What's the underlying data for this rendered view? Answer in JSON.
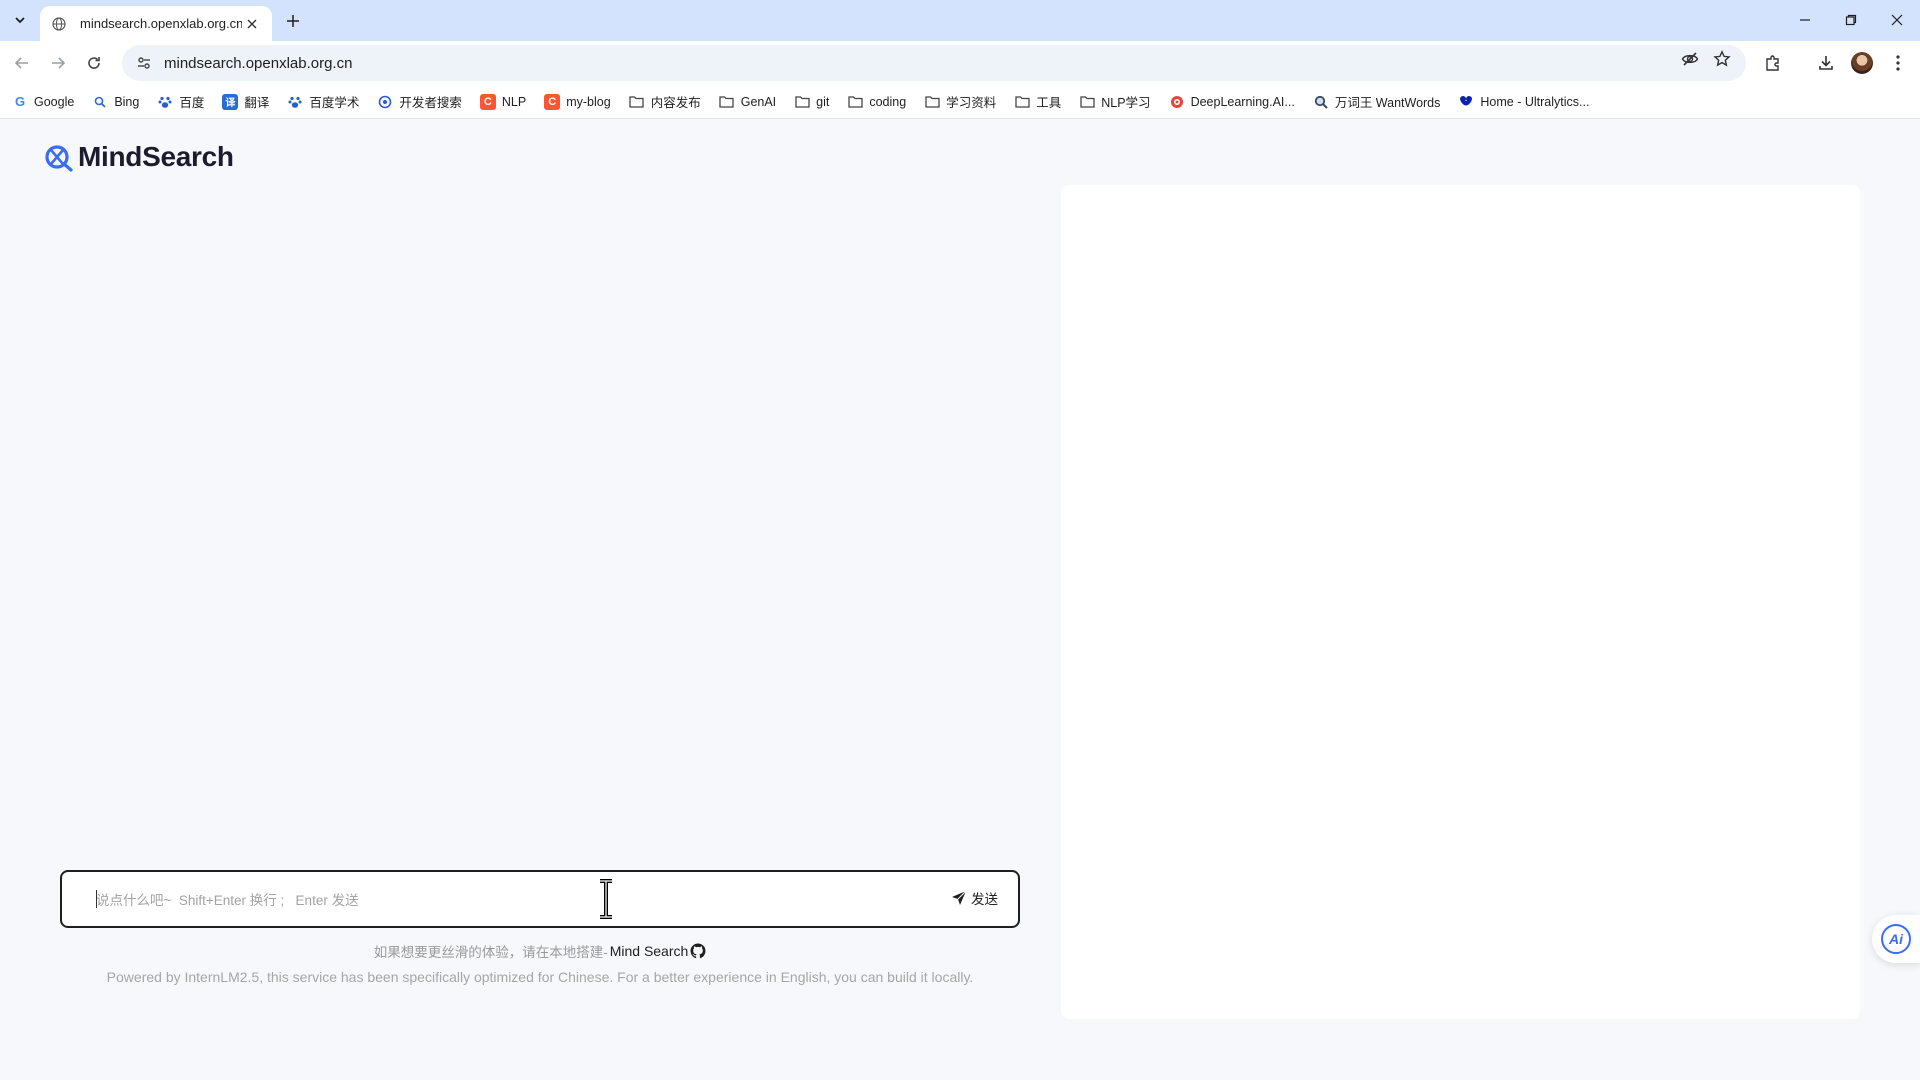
{
  "browser": {
    "tab": {
      "title": "mindsearch.openxlab.org.cn"
    },
    "address": {
      "url": "mindsearch.openxlab.org.cn"
    },
    "bookmarks": [
      {
        "label": "Google",
        "icon": "google-icon"
      },
      {
        "label": "Bing",
        "icon": "bing-search-icon"
      },
      {
        "label": "百度",
        "icon": "baidu-paw-icon"
      },
      {
        "label": "翻译",
        "icon": "translate-icon"
      },
      {
        "label": "百度学术",
        "icon": "baidu-paw-icon"
      },
      {
        "label": "开发者搜索",
        "icon": "dev-search-icon"
      },
      {
        "label": "NLP",
        "icon": "csdn-icon"
      },
      {
        "label": "my-blog",
        "icon": "csdn-icon"
      },
      {
        "label": "内容发布",
        "icon": "folder-icon"
      },
      {
        "label": "GenAI",
        "icon": "folder-icon"
      },
      {
        "label": "git",
        "icon": "folder-icon"
      },
      {
        "label": "coding",
        "icon": "folder-icon"
      },
      {
        "label": "学习资料",
        "icon": "folder-icon"
      },
      {
        "label": "工具",
        "icon": "folder-icon"
      },
      {
        "label": "NLP学习",
        "icon": "folder-icon"
      },
      {
        "label": "DeepLearning.AI...",
        "icon": "deeplearning-icon"
      },
      {
        "label": "万词王 WantWords",
        "icon": "magnifier-icon"
      },
      {
        "label": "Home - Ultralytics...",
        "icon": "ultralytics-icon"
      }
    ]
  },
  "app": {
    "logo_text": "MindSearch",
    "chat": {
      "placeholder": "说点什么吧~  Shift+Enter 换行 ;   Enter 发送",
      "send_label": "发送"
    },
    "local_note": "如果想要更丝滑的体验，请在本地搭建-",
    "local_link": "Mind Search",
    "powered_by": "Powered by InternLM2.5, this service has been specifically optimized for Chinese. For a better experience in English, you can build it locally.",
    "fab_label": "Ai"
  },
  "colors": {
    "accent": "#3b6df0",
    "tab_strip": "#d3e3fd",
    "page_bg": "#f6f8fc"
  }
}
